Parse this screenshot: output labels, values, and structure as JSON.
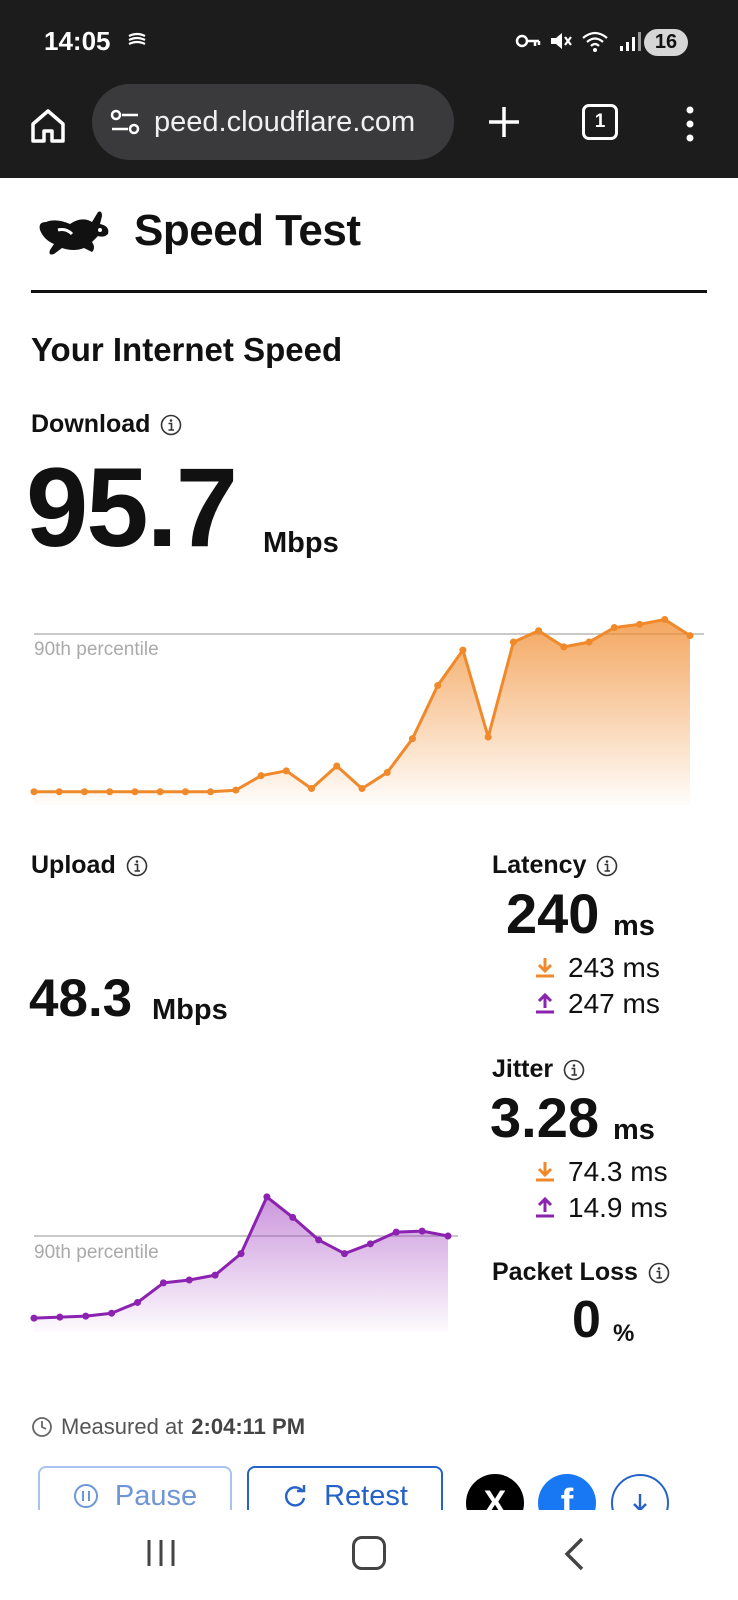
{
  "status_bar": {
    "time": "14:05",
    "battery": "16",
    "icons": [
      "vpn-key",
      "mute",
      "wifi",
      "signal"
    ]
  },
  "browser": {
    "url": "peed.cloudflare.com",
    "tab_count": "1"
  },
  "site": {
    "title": "Speed Test"
  },
  "main": {
    "heading": "Your Internet Speed",
    "download": {
      "label": "Download",
      "value": "95.7",
      "unit": "Mbps"
    },
    "upload": {
      "label": "Upload",
      "value": "48.3",
      "unit": "Mbps"
    },
    "latency": {
      "label": "Latency",
      "value": "240",
      "unit": "ms",
      "down": "243 ms",
      "up": "247 ms"
    },
    "jitter": {
      "label": "Jitter",
      "value": "3.28",
      "unit": "ms",
      "down": "74.3 ms",
      "up": "14.9 ms"
    },
    "packet_loss": {
      "label": "Packet Loss",
      "value": "0",
      "unit": "%"
    },
    "measured_prefix": "Measured at",
    "measured_time": "2:04:11 PM"
  },
  "buttons": {
    "pause": "Pause",
    "retest": "Retest",
    "x_label": "X",
    "fb_label": "f"
  },
  "colors": {
    "download": "#f0892a",
    "upload": "#8b22b0",
    "accent": "#2563c9"
  },
  "chart_data": [
    {
      "type": "area",
      "series": [
        {
          "name": "",
          "values": [
            0.02,
            0.02,
            0.02,
            0.02,
            0.02,
            0.02,
            0.02,
            0.02,
            0.03,
            0.12,
            0.15,
            0.04,
            0.18,
            0.04,
            0.14,
            0.35,
            0.68,
            0.9,
            0.36,
            0.95,
            1.02,
            0.92,
            0.95,
            1.04,
            1.06,
            1.09,
            0.99
          ]
        }
      ],
      "reference_line": {
        "label": "90th percentile",
        "value": 1.0
      }
    },
    {
      "type": "area",
      "series": [
        {
          "name": "",
          "values": [
            0.04,
            0.05,
            0.06,
            0.09,
            0.2,
            0.4,
            0.43,
            0.48,
            0.7,
            1.28,
            1.07,
            0.84,
            0.7,
            0.8,
            0.92,
            0.93,
            0.88
          ]
        }
      ],
      "reference_line": {
        "label": "90th percentile",
        "value": 0.88
      }
    }
  ]
}
